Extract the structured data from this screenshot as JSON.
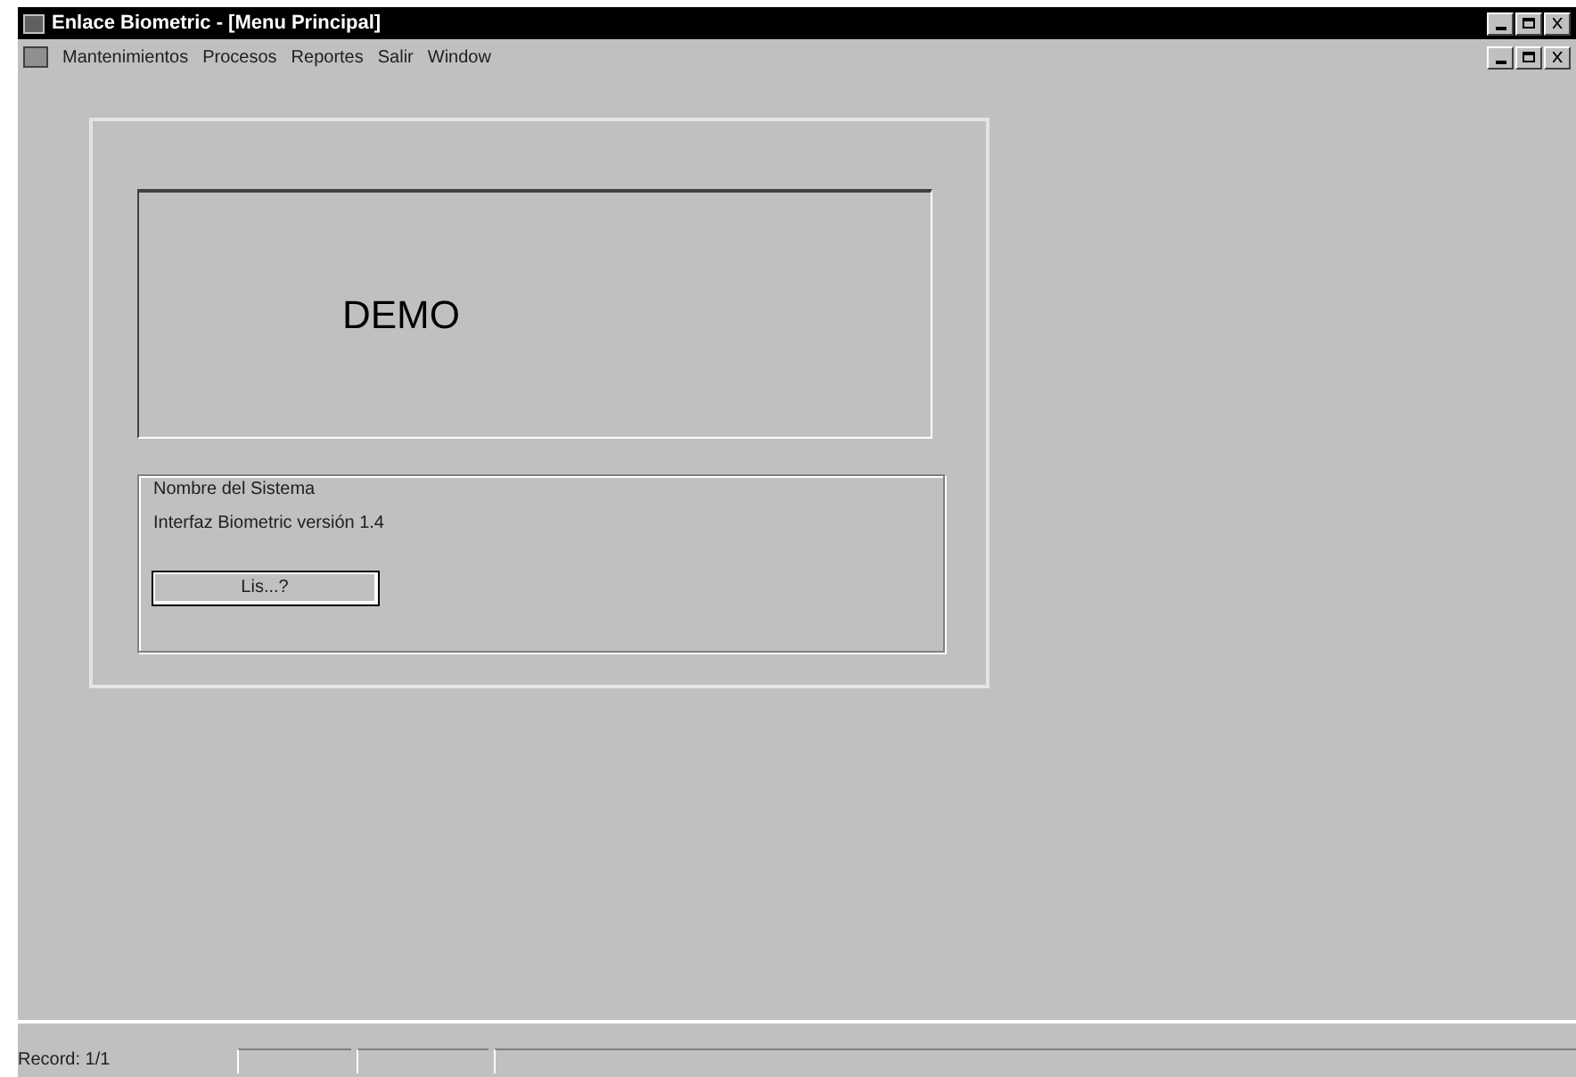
{
  "window": {
    "title": "Enlace Biometric - [Menu Principal]"
  },
  "menu": [
    "Mantenimientos",
    "Procesos",
    "Reportes",
    "Salir",
    "Window"
  ],
  "banner": {
    "text": "DEMO"
  },
  "info": {
    "lines": [
      "Nombre del Sistema",
      "Interfaz Biometric versión 1.4"
    ],
    "button": "Lis...?"
  },
  "status_bar": {
    "record": "Record: 1/1"
  }
}
